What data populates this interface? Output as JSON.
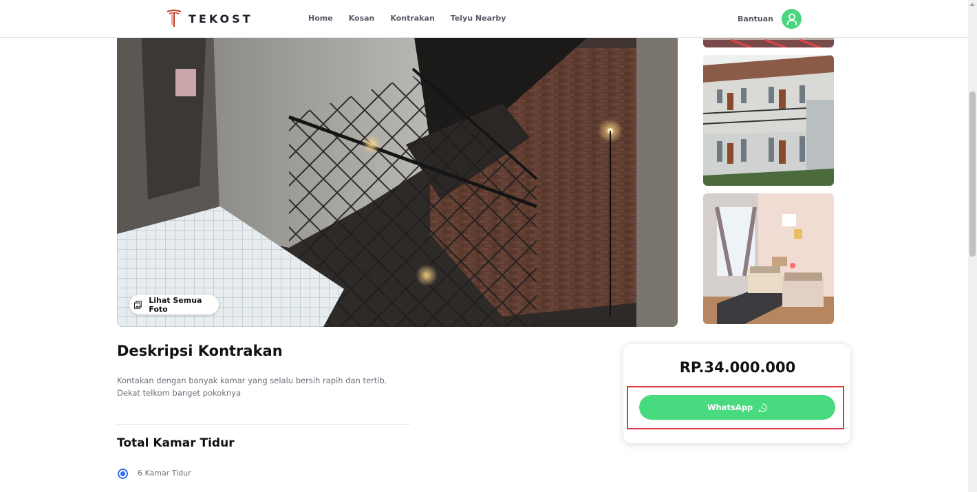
{
  "header": {
    "brand": "TEKOST",
    "nav": [
      "Home",
      "Kosan",
      "Kontrakan",
      "Telyu Nearby"
    ],
    "help_label": "Bantuan",
    "profile_icon": "user-icon"
  },
  "gallery": {
    "view_all_label": "Lihat Semua Foto",
    "view_all_icon": "gallery-icon"
  },
  "description": {
    "title": "Deskripsi Kontrakan",
    "text": "Kontakan dengan banyak kamar yang selalu bersih rapih dan tertib. Dekat telkom banget pokoknya"
  },
  "rooms": {
    "title": "Total Kamar Tidur",
    "selected_option": "6 Kamar Tidur"
  },
  "pricing": {
    "price": "RP.34.000.000",
    "whatsapp_label": "WhatsApp",
    "whatsapp_icon": "whatsapp-icon"
  },
  "colors": {
    "accent_green": "#48da7f",
    "avatar_green": "#4cd57f",
    "highlight_red": "#d9383d",
    "radio_blue": "#2d6cf0",
    "logo_red": "#c0392b"
  }
}
